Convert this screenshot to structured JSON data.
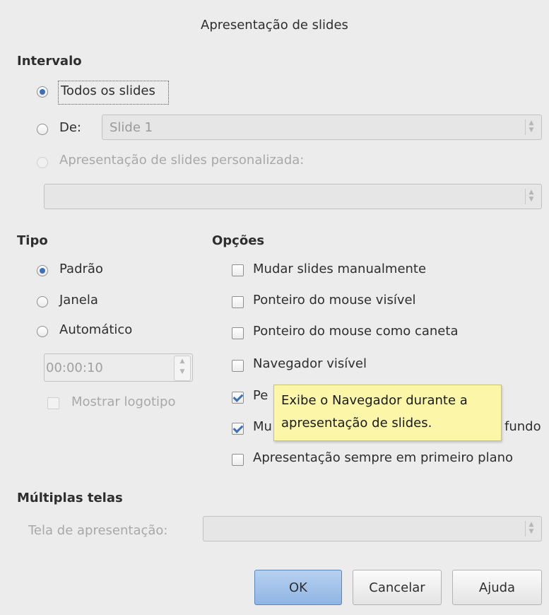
{
  "window": {
    "title": "Apresentação de slides"
  },
  "intervalo": {
    "heading": "Intervalo",
    "all_slides": "Todos os slides",
    "from_label": "De:",
    "from_value": "Slide 1",
    "custom_label": "Apresentação de slides personalizada:",
    "custom_value": ""
  },
  "tipo": {
    "heading": "Tipo",
    "default": "Padrão",
    "window": "Janela",
    "auto": "Automático",
    "duration": "00:00:10",
    "show_logo": "Mostrar logotipo"
  },
  "opcoes": {
    "heading": "Opções",
    "items": [
      {
        "label": "Mudar slides manualmente",
        "checked": false
      },
      {
        "label": "Ponteiro do mouse visível",
        "checked": false
      },
      {
        "label": "Ponteiro do mouse como caneta",
        "checked": false
      },
      {
        "label": "Navegador visível",
        "checked": false
      },
      {
        "label": "Pe",
        "checked": true
      },
      {
        "label": "Mu",
        "checked": true
      },
      {
        "label": "Apresentação sempre em primeiro plano",
        "checked": false
      }
    ],
    "item6_tail": "fundo"
  },
  "multiplas": {
    "heading": "Múltiplas telas",
    "screen_label": "Tela de apresentação:",
    "screen_value": ""
  },
  "tooltip": {
    "line1": "Exibe o Navegador durante a",
    "line2": "apresentação de slides."
  },
  "buttons": {
    "ok": "OK",
    "cancel": "Cancelar",
    "help": "Ajuda"
  },
  "colors": {
    "accent": "#3d70b8",
    "tooltip_bg": "#fbf6a8",
    "default_button": "#a8c6ec"
  }
}
